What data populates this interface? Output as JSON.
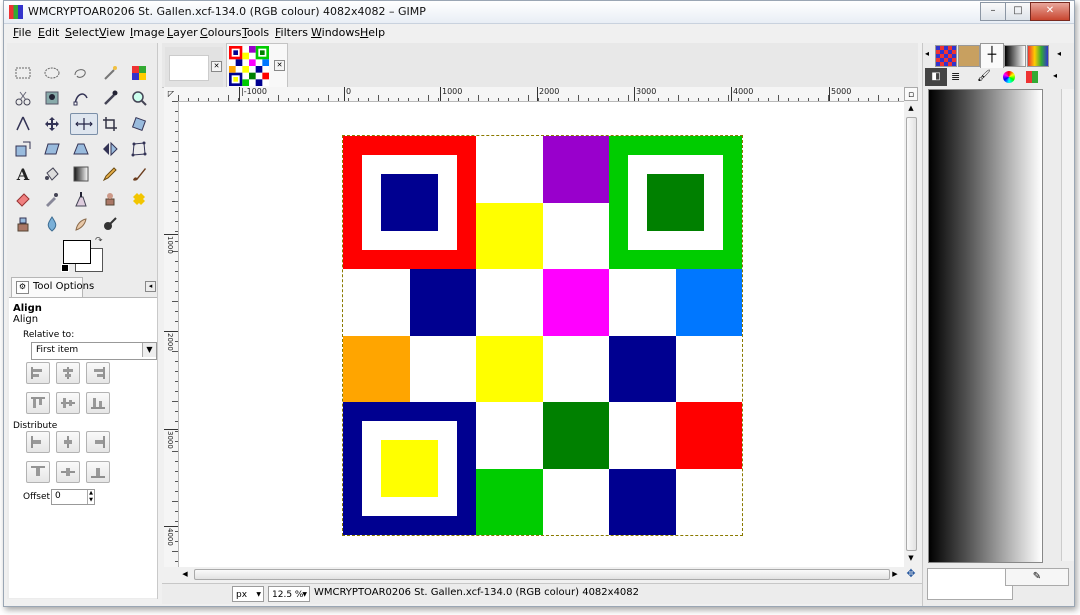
{
  "window": {
    "title": "WMCRYPTOAR0206 St. Gallen.xcf-134.0 (RGB colour) 4082x4082 – GIMP",
    "controls": [
      "–",
      "□",
      "✕"
    ]
  },
  "menu": [
    "File",
    "Edit",
    "Select",
    "View",
    "Image",
    "Layer",
    "Colours",
    "Tools",
    "Filters",
    "Windows",
    "Help"
  ],
  "tool_options": {
    "tab_label": "Tool Options",
    "heading": "Align",
    "subheading": "Align",
    "relative_label": "Relative to:",
    "relative_value": "First item",
    "distribute_label": "Distribute",
    "offset_label": "Offset:",
    "offset_value": "0"
  },
  "image_tabs": [
    {
      "name": "blank-image",
      "active": false
    },
    {
      "name": "qr-image",
      "active": true
    }
  ],
  "rulers": {
    "h_ticks": [
      {
        "label": "|-1000",
        "at": 61
      },
      {
        "label": "0",
        "at": 166
      },
      {
        "label": "1000",
        "at": 262
      },
      {
        "label": "2000",
        "at": 359
      },
      {
        "label": "3000",
        "at": 456
      },
      {
        "label": "4000",
        "at": 553
      },
      {
        "label": "5000",
        "at": 651
      }
    ],
    "v_ticks": [
      {
        "label": "1000",
        "at": 133
      },
      {
        "label": "2000",
        "at": 230
      },
      {
        "label": "3000",
        "at": 328
      },
      {
        "label": "4000",
        "at": 425
      }
    ]
  },
  "status": {
    "unit": "px",
    "zoom": "12.5 %",
    "text": "WMCRYPTOAR0206 St. Gallen.xcf-134.0 (RGB colour) 4082x4082"
  },
  "colors": {
    "red": "#ff0000",
    "green": "#00cc00",
    "dark_green": "#008000",
    "navy": "#000090",
    "yellow": "#ffff00",
    "purple": "#9900cc",
    "magenta": "#ff00ff",
    "blue": "#0077ff",
    "orange": "#ffa500",
    "white": "#ffffff"
  },
  "image_grid": [
    [
      "red-finder",
      "red-finder",
      "white",
      "purple",
      "green-finder",
      "green-finder"
    ],
    [
      "red-finder",
      "red-finder",
      "yellow",
      "white",
      "green-finder",
      "green-finder"
    ],
    [
      "white",
      "navy",
      "white",
      "magenta",
      "white",
      "blue"
    ],
    [
      "orange",
      "white",
      "yellow",
      "white",
      "navy",
      "white"
    ],
    [
      "navy-finder",
      "navy-finder",
      "white",
      "dark_green",
      "white",
      "red"
    ],
    [
      "navy-finder",
      "navy-finder",
      "green",
      "white",
      "navy",
      "white"
    ]
  ]
}
